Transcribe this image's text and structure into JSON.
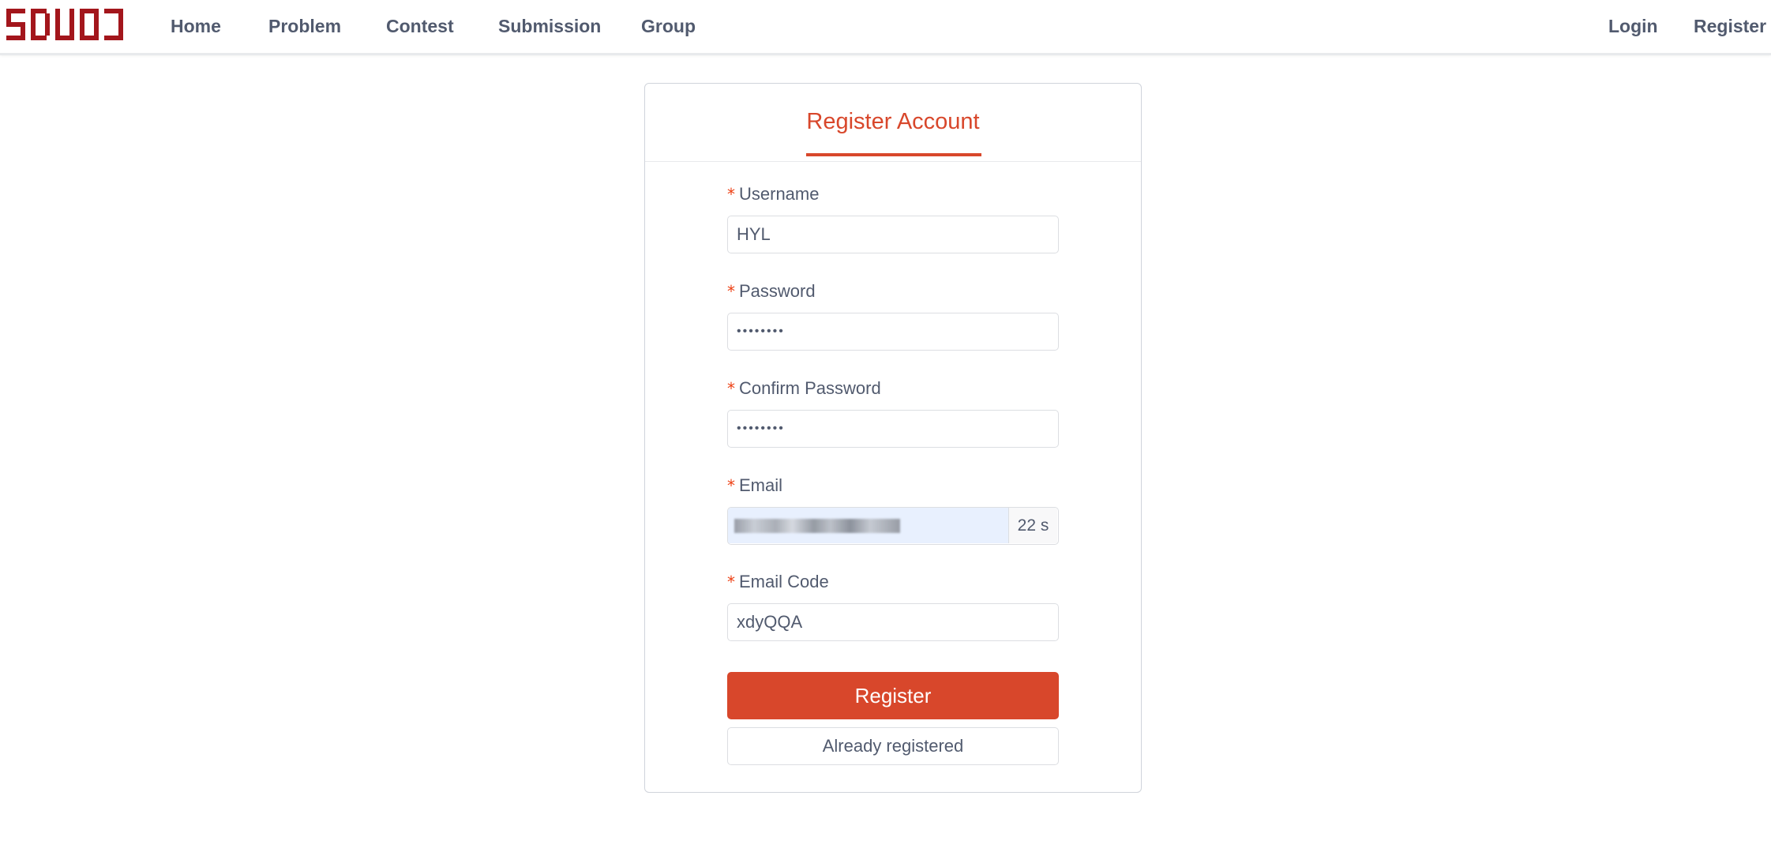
{
  "header": {
    "logo_text": "SDUOJ",
    "nav": [
      {
        "label": "Home"
      },
      {
        "label": "Problem"
      },
      {
        "label": "Contest"
      },
      {
        "label": "Submission"
      },
      {
        "label": "Group"
      }
    ],
    "login_label": "Login",
    "register_label": "Register"
  },
  "card": {
    "title": "Register Account"
  },
  "form": {
    "required_mark": "*",
    "username": {
      "label": "Username",
      "value": "HYL"
    },
    "password": {
      "label": "Password",
      "value": "••••••••"
    },
    "confirm_password": {
      "label": "Confirm Password",
      "value": "••••••••"
    },
    "email": {
      "label": "Email",
      "countdown": "22 s"
    },
    "email_code": {
      "label": "Email Code",
      "value": "xdyQQA"
    },
    "submit_label": "Register",
    "already_registered_label": "Already registered"
  },
  "colors": {
    "accent": "#d8472b",
    "required": "#ed4014",
    "text": "#515a6e",
    "border": "#dcdee2",
    "autofill_bg": "#e8f0fe"
  }
}
